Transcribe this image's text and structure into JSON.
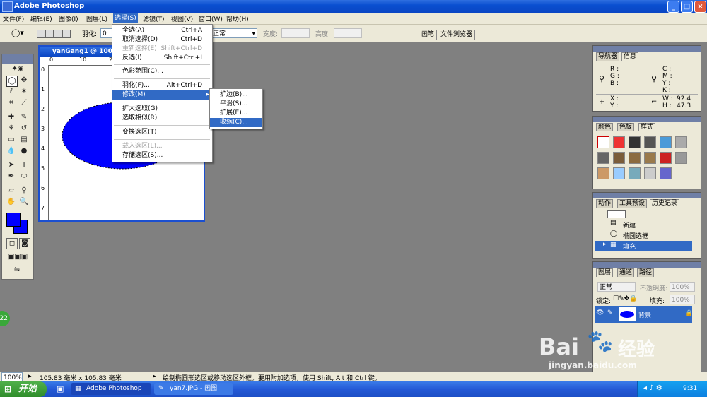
{
  "window": {
    "title": "Adobe Photoshop",
    "min": "_",
    "max": "□",
    "close": "×"
  },
  "menubar": [
    "文件(F)",
    "编辑(E)",
    "图像(I)",
    "图层(L)",
    "选择(S)",
    "滤镜(T)",
    "视图(V)",
    "窗口(W)",
    "帮助(H)"
  ],
  "options": {
    "feather_label": "羽化:",
    "feather_value": "0",
    "style_value": "正常",
    "width_label": "宽度:",
    "height_label": "高度:",
    "tabs": [
      "画笔",
      "文件浏览器"
    ]
  },
  "document": {
    "title": "yanGang1 @ 100%",
    "ruler_marks": [
      "0",
      "10",
      "20"
    ],
    "ruler_v": [
      "0",
      "1",
      "2",
      "3",
      "4",
      "5",
      "6",
      "7"
    ]
  },
  "select_menu": {
    "items": [
      {
        "label": "全选(A)",
        "shortcut": "Ctrl+A",
        "disabled": false
      },
      {
        "label": "取消选择(D)",
        "shortcut": "Ctrl+D",
        "disabled": false
      },
      {
        "label": "重新选择(E)",
        "shortcut": "Shift+Ctrl+D",
        "disabled": true
      },
      {
        "label": "反选(I)",
        "shortcut": "Shift+Ctrl+I",
        "disabled": false
      },
      {
        "label": "色彩范围(C)...",
        "shortcut": "",
        "disabled": false
      },
      {
        "label": "羽化(F)...",
        "shortcut": "Alt+Ctrl+D",
        "disabled": false
      },
      {
        "label": "修改(M)",
        "shortcut": "",
        "disabled": false,
        "highlight": true
      },
      {
        "label": "扩大选取(G)",
        "shortcut": "",
        "disabled": false
      },
      {
        "label": "选取相似(R)",
        "shortcut": "",
        "disabled": false
      },
      {
        "label": "变换选区(T)",
        "shortcut": "",
        "disabled": false
      },
      {
        "label": "载入选区(L)...",
        "shortcut": "",
        "disabled": true
      },
      {
        "label": "存储选区(S)...",
        "shortcut": "",
        "disabled": false
      }
    ]
  },
  "modify_menu": {
    "items": [
      {
        "label": "扩边(B)..."
      },
      {
        "label": "平滑(S)..."
      },
      {
        "label": "扩展(E)..."
      },
      {
        "label": "收缩(C)...",
        "highlight": true
      }
    ]
  },
  "panels": {
    "navigator": {
      "tabs": [
        "导航器",
        "信息"
      ],
      "r": "R :",
      "g": "G :",
      "b": "B :",
      "c": "C :",
      "m": "M :",
      "y": "Y :",
      "k": "K :",
      "x": "X :",
      "y2": "Y :",
      "w": "W :",
      "h": "H :",
      "w_val": "92.4",
      "h_val": "47.3"
    },
    "styles": {
      "tabs": [
        "颜色",
        "色板",
        "样式"
      ]
    },
    "history": {
      "tabs": [
        "动作",
        "工具预设",
        "历史记录"
      ],
      "items": [
        "新建",
        "椭圆选框",
        "填充"
      ]
    },
    "layers": {
      "tabs": [
        "图层",
        "通道",
        "路径"
      ],
      "blend": "正常",
      "opacity_label": "不透明度:",
      "opacity_value": "100%",
      "lock_label": "锁定:",
      "fill_label": "填充:",
      "fill_value": "100%",
      "layer_name": "背景"
    }
  },
  "status": {
    "zoom": "100%",
    "size": "105.83 毫米 x 105.83 毫米",
    "hint": "绘制椭圆形选区或移动选区外框。要用附加选项，使用 Shift, Alt 和 Ctrl 键。"
  },
  "taskbar": {
    "start": "开始",
    "items": [
      "Adobe Photoshop",
      "yan7.JPG - 画图"
    ],
    "time": "9:31"
  },
  "watermark": {
    "logo": "Bai",
    "logo2": "经验",
    "url": "jingyan.baidu.com"
  },
  "side_badge": "22",
  "colors": {
    "fill": "#0000ff",
    "menu_highlight": "#316ac5",
    "title": "#0a46c4"
  }
}
